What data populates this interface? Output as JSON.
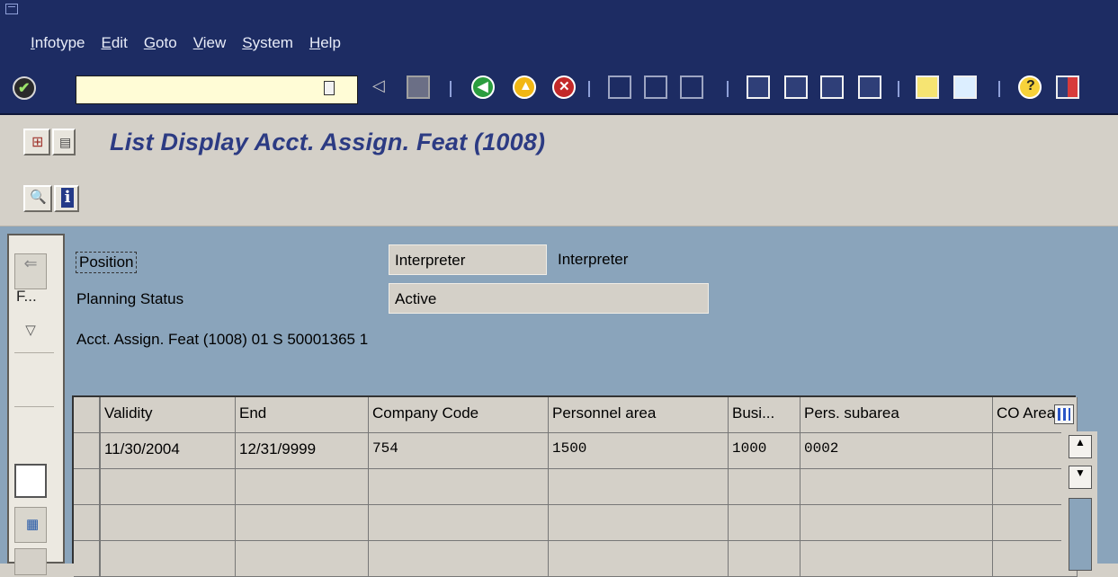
{
  "menubar": {
    "items": [
      "Infotype",
      "Edit",
      "Goto",
      "View",
      "System",
      "Help"
    ]
  },
  "toolbar": {
    "command_value": "",
    "icons": [
      "enter-icon",
      "back-icon",
      "save-icon",
      "green-back-icon",
      "exit-icon",
      "cancel-icon",
      "print-icon",
      "find-icon",
      "find-next-icon",
      "first-page-icon",
      "prev-page-icon",
      "next-page-icon",
      "last-page-icon",
      "new-session-icon",
      "shortcut-icon",
      "help-icon",
      "layout-icon"
    ]
  },
  "title": "List Display Acct. Assign. Feat (1008)",
  "header": {
    "position_label": "Position",
    "position_value": "Interpreter",
    "position_desc": "Interpreter",
    "status_label": "Planning Status",
    "status_value": "Active",
    "object_line": "Acct. Assign. Feat (1008) 01 S  50001365 1"
  },
  "nav": {
    "f_label": "F..."
  },
  "table": {
    "columns": [
      "Validity",
      "End",
      "Company Code",
      "Personnel area",
      "Busi...",
      "Pers. subarea",
      "CO Area"
    ],
    "rows": [
      [
        "11/30/2004",
        "12/31/9999",
        "754",
        "1500",
        "1000",
        "0002",
        ""
      ],
      [
        "",
        "",
        "",
        "",
        "",
        "",
        ""
      ],
      [
        "",
        "",
        "",
        "",
        "",
        "",
        ""
      ],
      [
        "",
        "",
        "",
        "",
        "",
        "",
        ""
      ]
    ]
  }
}
